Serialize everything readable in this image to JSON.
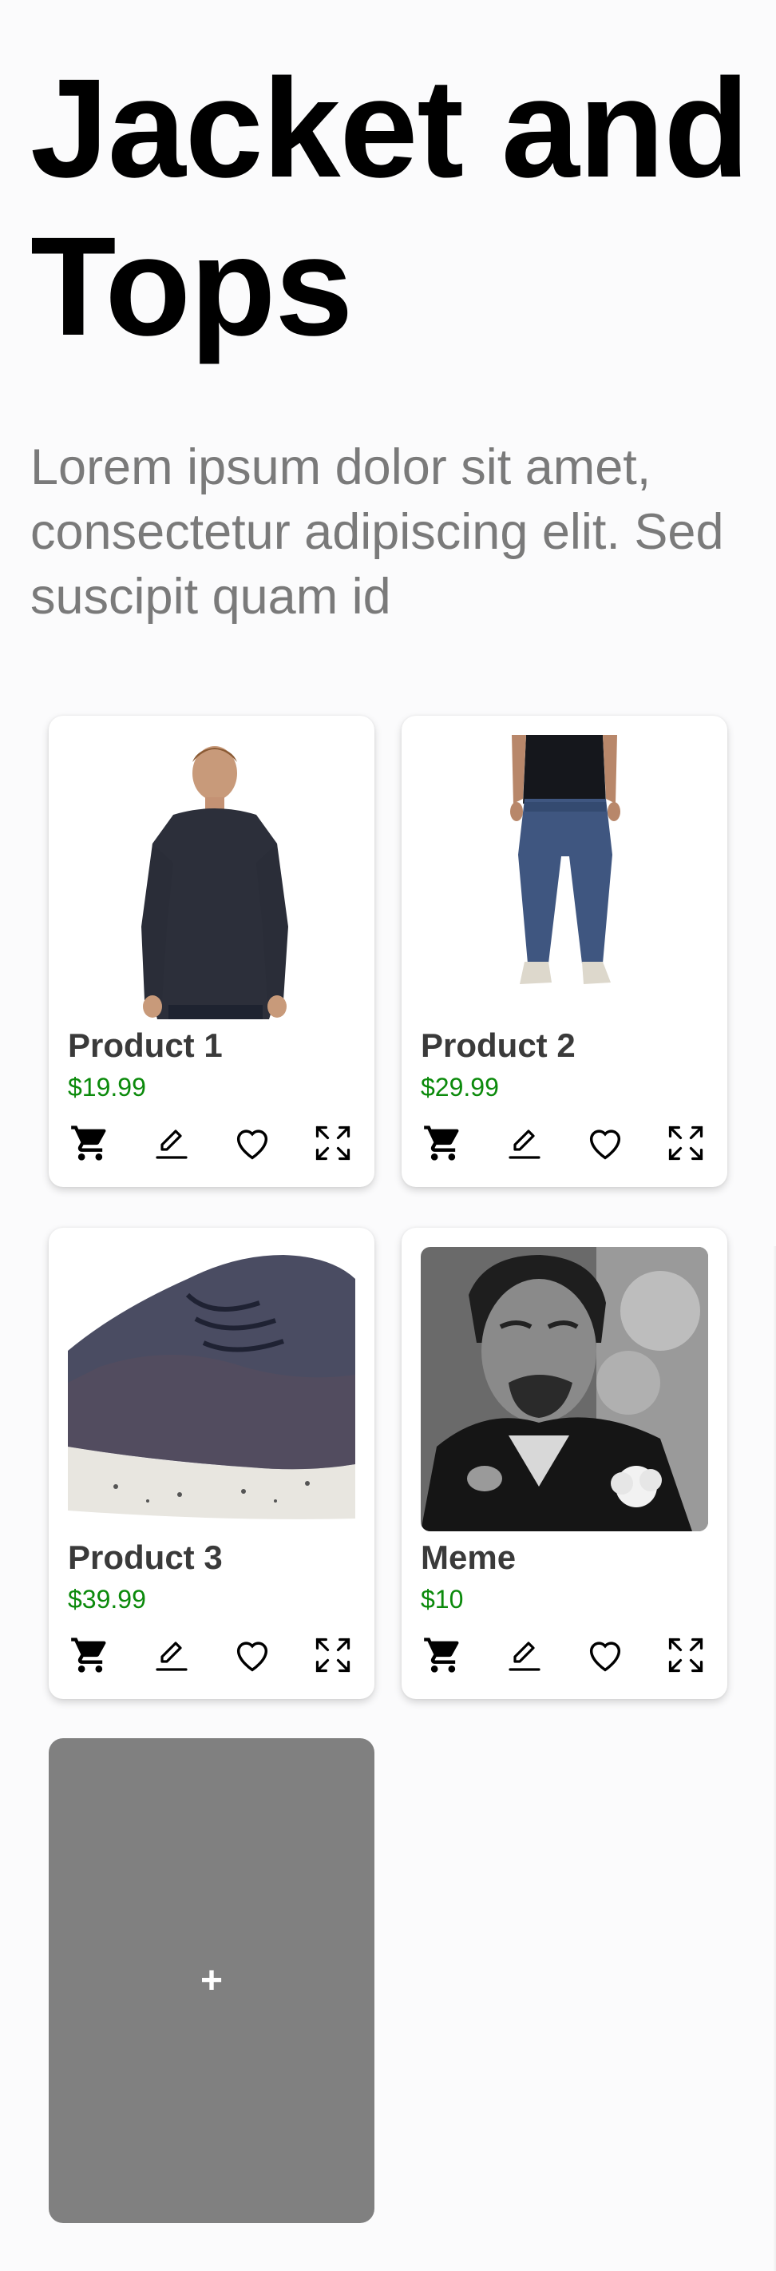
{
  "header": {
    "title": "Jacket and Tops",
    "subtitle": "Lorem ipsum dolor sit amet, consectetur adipiscing elit. Sed suscipit quam id"
  },
  "products": [
    {
      "name": "Product 1",
      "price": "$19.99",
      "image": "man-in-long-sleeve-shirt"
    },
    {
      "name": "Product 2",
      "price": "$29.99",
      "image": "blue-jeans-on-model"
    },
    {
      "name": "Product 3",
      "price": "$39.99",
      "image": "knit-sneaker"
    },
    {
      "name": "Meme",
      "price": "$10",
      "image": "laughing-man-meme"
    }
  ],
  "actions": [
    "cart-icon",
    "edit-icon",
    "heart-icon",
    "expand-icon"
  ],
  "add_card": {
    "label": "+"
  },
  "colors": {
    "price": "#0b8a0b",
    "add_card_bg": "#808080",
    "subtitle": "#7a7a7a"
  }
}
